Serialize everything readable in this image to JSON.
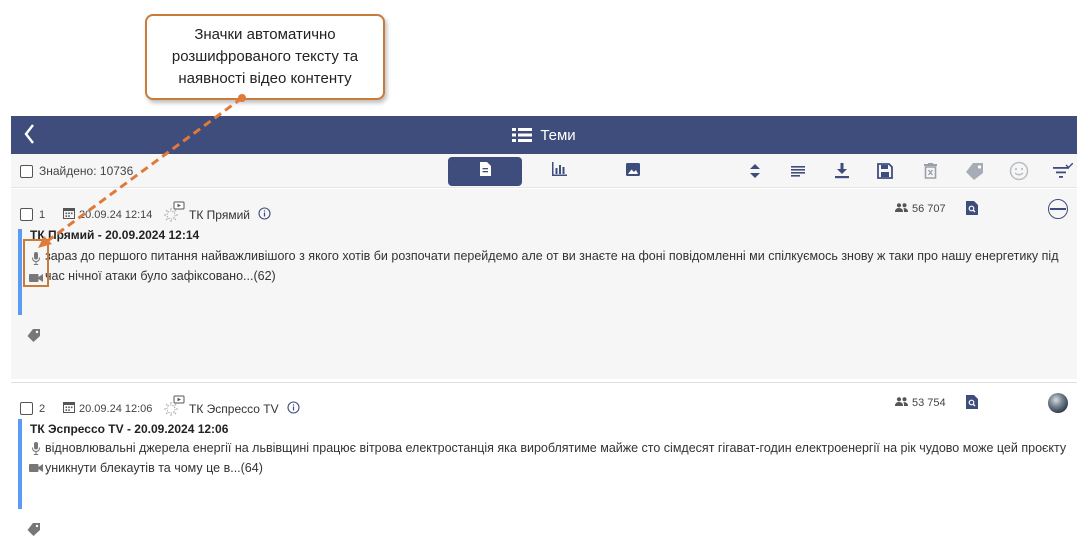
{
  "callout": {
    "lines": [
      "Значки автоматично",
      "розшифрованого тексту та",
      "наявності відео контенту"
    ]
  },
  "header": {
    "title": "Теми",
    "back_icon": "chevron-left-icon",
    "title_icon": "list-icon"
  },
  "toolbar": {
    "found_label": "Знайдено: 10736",
    "views": [
      "document-icon",
      "bar-chart-icon",
      "image-icon"
    ],
    "actions": [
      "sort-icon",
      "text-lines-icon",
      "download-icon",
      "save-icon",
      "delete-icon",
      "tag-icon",
      "sentiment-icon",
      "filter-icon"
    ]
  },
  "items": [
    {
      "num": "1",
      "date": "20.09.24 12:14",
      "source": "ТК Прямий",
      "audience": "56 707",
      "headline": "ТК Прямий - 20.09.2024 12:14",
      "text": "зараз до першого питання найважливішого з якого хотів би розпочати перейдемо але от ви знаєте на фоні повідомленні ми спілкуємось знову ж таки про нашу енергетику під час нічної атаки було зафіксовано...(62)"
    },
    {
      "num": "2",
      "date": "20.09.24 12:06",
      "source": "ТК Эспрессо TV",
      "audience": "53 754",
      "headline": "ТК Эспрессо TV - 20.09.2024 12:06",
      "text": "відновлювальні джерела енергії на львівщині працює вітрова електростанція яка виробляти­ме майже сто сімдесят гігават-годин електроенергії на рік чудово може цей проєкту уникнути блекаутів та чому це в...(64)"
    }
  ],
  "colors": {
    "header": "#3f4d7c",
    "accent_bar": "#5a9bf5",
    "callout_border": "#c97b3a",
    "arrow": "#e07a3a"
  }
}
